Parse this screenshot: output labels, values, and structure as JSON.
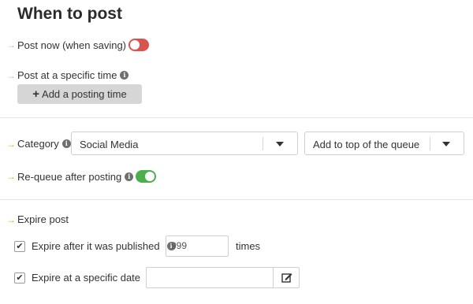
{
  "page": {
    "title": "When to post"
  },
  "post_now": {
    "label": "Post now (when saving)",
    "toggle_on": false
  },
  "specific_time": {
    "label": "Post at a specific time",
    "add_button_label": "Add a posting time"
  },
  "category": {
    "label": "Category",
    "selected": "Social Media",
    "queue_position": "Add to top of the queue"
  },
  "requeue": {
    "label": "Re-queue after posting",
    "toggle_on": true
  },
  "expire": {
    "label": "Expire post",
    "after_published_label": "Expire after it was published",
    "after_published_checked": true,
    "after_published_value": "999",
    "times_label": "times",
    "specific_date_label": "Expire at a specific date",
    "specific_date_checked": true,
    "specific_date_value": ""
  },
  "icons": {
    "arrow": "arrow-right-icon",
    "info": "info-icon",
    "plus": "plus-icon",
    "caret": "caret-down-icon",
    "check": "check-icon",
    "edit": "edit-icon"
  },
  "colors": {
    "toggle_off": "#d9534f",
    "toggle_on": "#4cae4c",
    "arrow_inactive": "#bdbdbd",
    "arrow_active": "#e5a91a",
    "button_bg": "#d6d6d6"
  }
}
